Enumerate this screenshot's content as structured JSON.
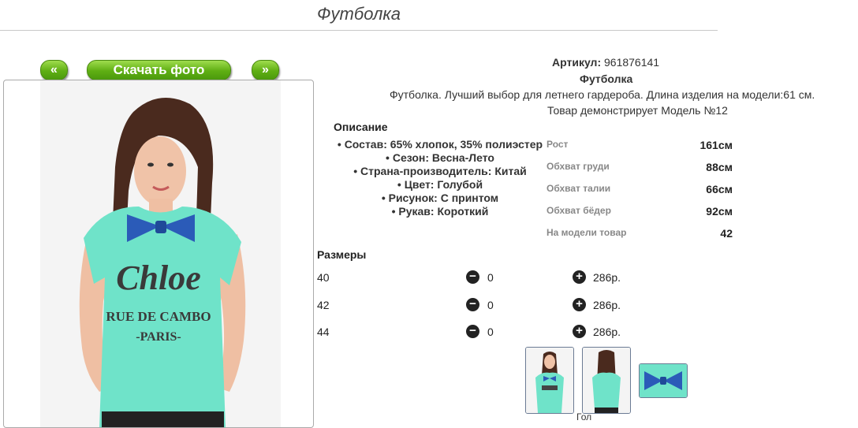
{
  "page": {
    "title": "Футболка"
  },
  "nav": {
    "prev": "«",
    "download": "Скачать фото",
    "next": "»"
  },
  "photo": {
    "print_line1": "Chloe",
    "print_line2": "RUE DE CAMBO",
    "print_line3": "-PARIS-"
  },
  "product": {
    "article_label": "Артикул:",
    "article_value": "961876141",
    "name": "Футболка",
    "description": "Футболка. Лучший выбор для летнего гардероба. Длина изделия на модели:61 см.",
    "model_note": "Товар демонстрирует Модель №12"
  },
  "description": {
    "heading": "Описание",
    "items": [
      "Состав: 65% хлопок, 35% полиэстер",
      "Сезон: Весна-Лето",
      "Страна-производитель: Китай",
      "Цвет: Голубой",
      "Рисунок: С принтом",
      "Рукав: Короткий"
    ]
  },
  "measurements": [
    {
      "label": "Рост",
      "value": "161см"
    },
    {
      "label": "Обхват груди",
      "value": "88см"
    },
    {
      "label": "Обхват талии",
      "value": "66см"
    },
    {
      "label": "Обхват бёдер",
      "value": "92см"
    },
    {
      "label": "На модели товар",
      "value": "42"
    }
  ],
  "sizes": {
    "heading": "Размеры",
    "rows": [
      {
        "size": "40",
        "qty": "0",
        "price": "286р."
      },
      {
        "size": "42",
        "qty": "0",
        "price": "286р."
      },
      {
        "size": "44",
        "qty": "0",
        "price": "286р."
      }
    ],
    "minus_icon": "minus-circle-icon",
    "plus_icon": "plus-circle-icon"
  },
  "thumbnails": {
    "label": "Гол"
  },
  "colors": {
    "accent_green": "#5fae13",
    "shirt_mint": "#6fe3c9",
    "bow_blue": "#2b5bb8"
  }
}
